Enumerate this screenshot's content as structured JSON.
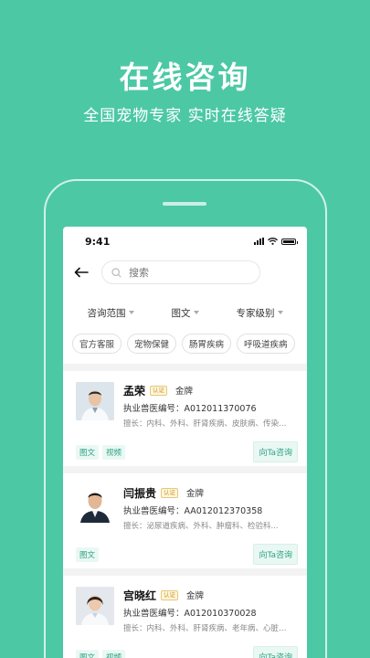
{
  "promo": {
    "title": "在线咨询",
    "subtitle": "全国宠物专家  实时在线答疑"
  },
  "status_bar": {
    "time": "9:41"
  },
  "search": {
    "placeholder": "搜索"
  },
  "filters": [
    {
      "label": "咨询范围"
    },
    {
      "label": "图文"
    },
    {
      "label": "专家级别"
    }
  ],
  "tags": [
    "官方客服",
    "宠物保健",
    "肠胃疾病",
    "呼吸道疾病"
  ],
  "doctors": [
    {
      "name": "孟荣",
      "verified": "认证",
      "level": "金牌",
      "license": "执业兽医编号：A012011370076",
      "specialty": "擅长：内科、外科、肝肾疾病、皮肤病、传染病、...",
      "modes": [
        "图文",
        "视频"
      ],
      "consult": "向Ta咨询"
    },
    {
      "name": "闫振贵",
      "verified": "认证",
      "level": "金牌",
      "license": "执业兽医编号：AA012012370358",
      "specialty": "擅长：泌尿道疾病、外科、肿瘤科、检验科...",
      "modes": [
        "图文"
      ],
      "consult": "向Ta咨询"
    },
    {
      "name": "宫晓红",
      "verified": "认证",
      "level": "金牌",
      "license": "执业兽医编号：A012010370028",
      "specialty": "擅长：内科、外科、肝肾疾病、老年病、心脏病...",
      "modes": [
        "图文",
        "视频"
      ],
      "consult": "向Ta咨询"
    }
  ],
  "colors": {
    "background": "#4cc8a5",
    "accent": "#2ba283"
  }
}
